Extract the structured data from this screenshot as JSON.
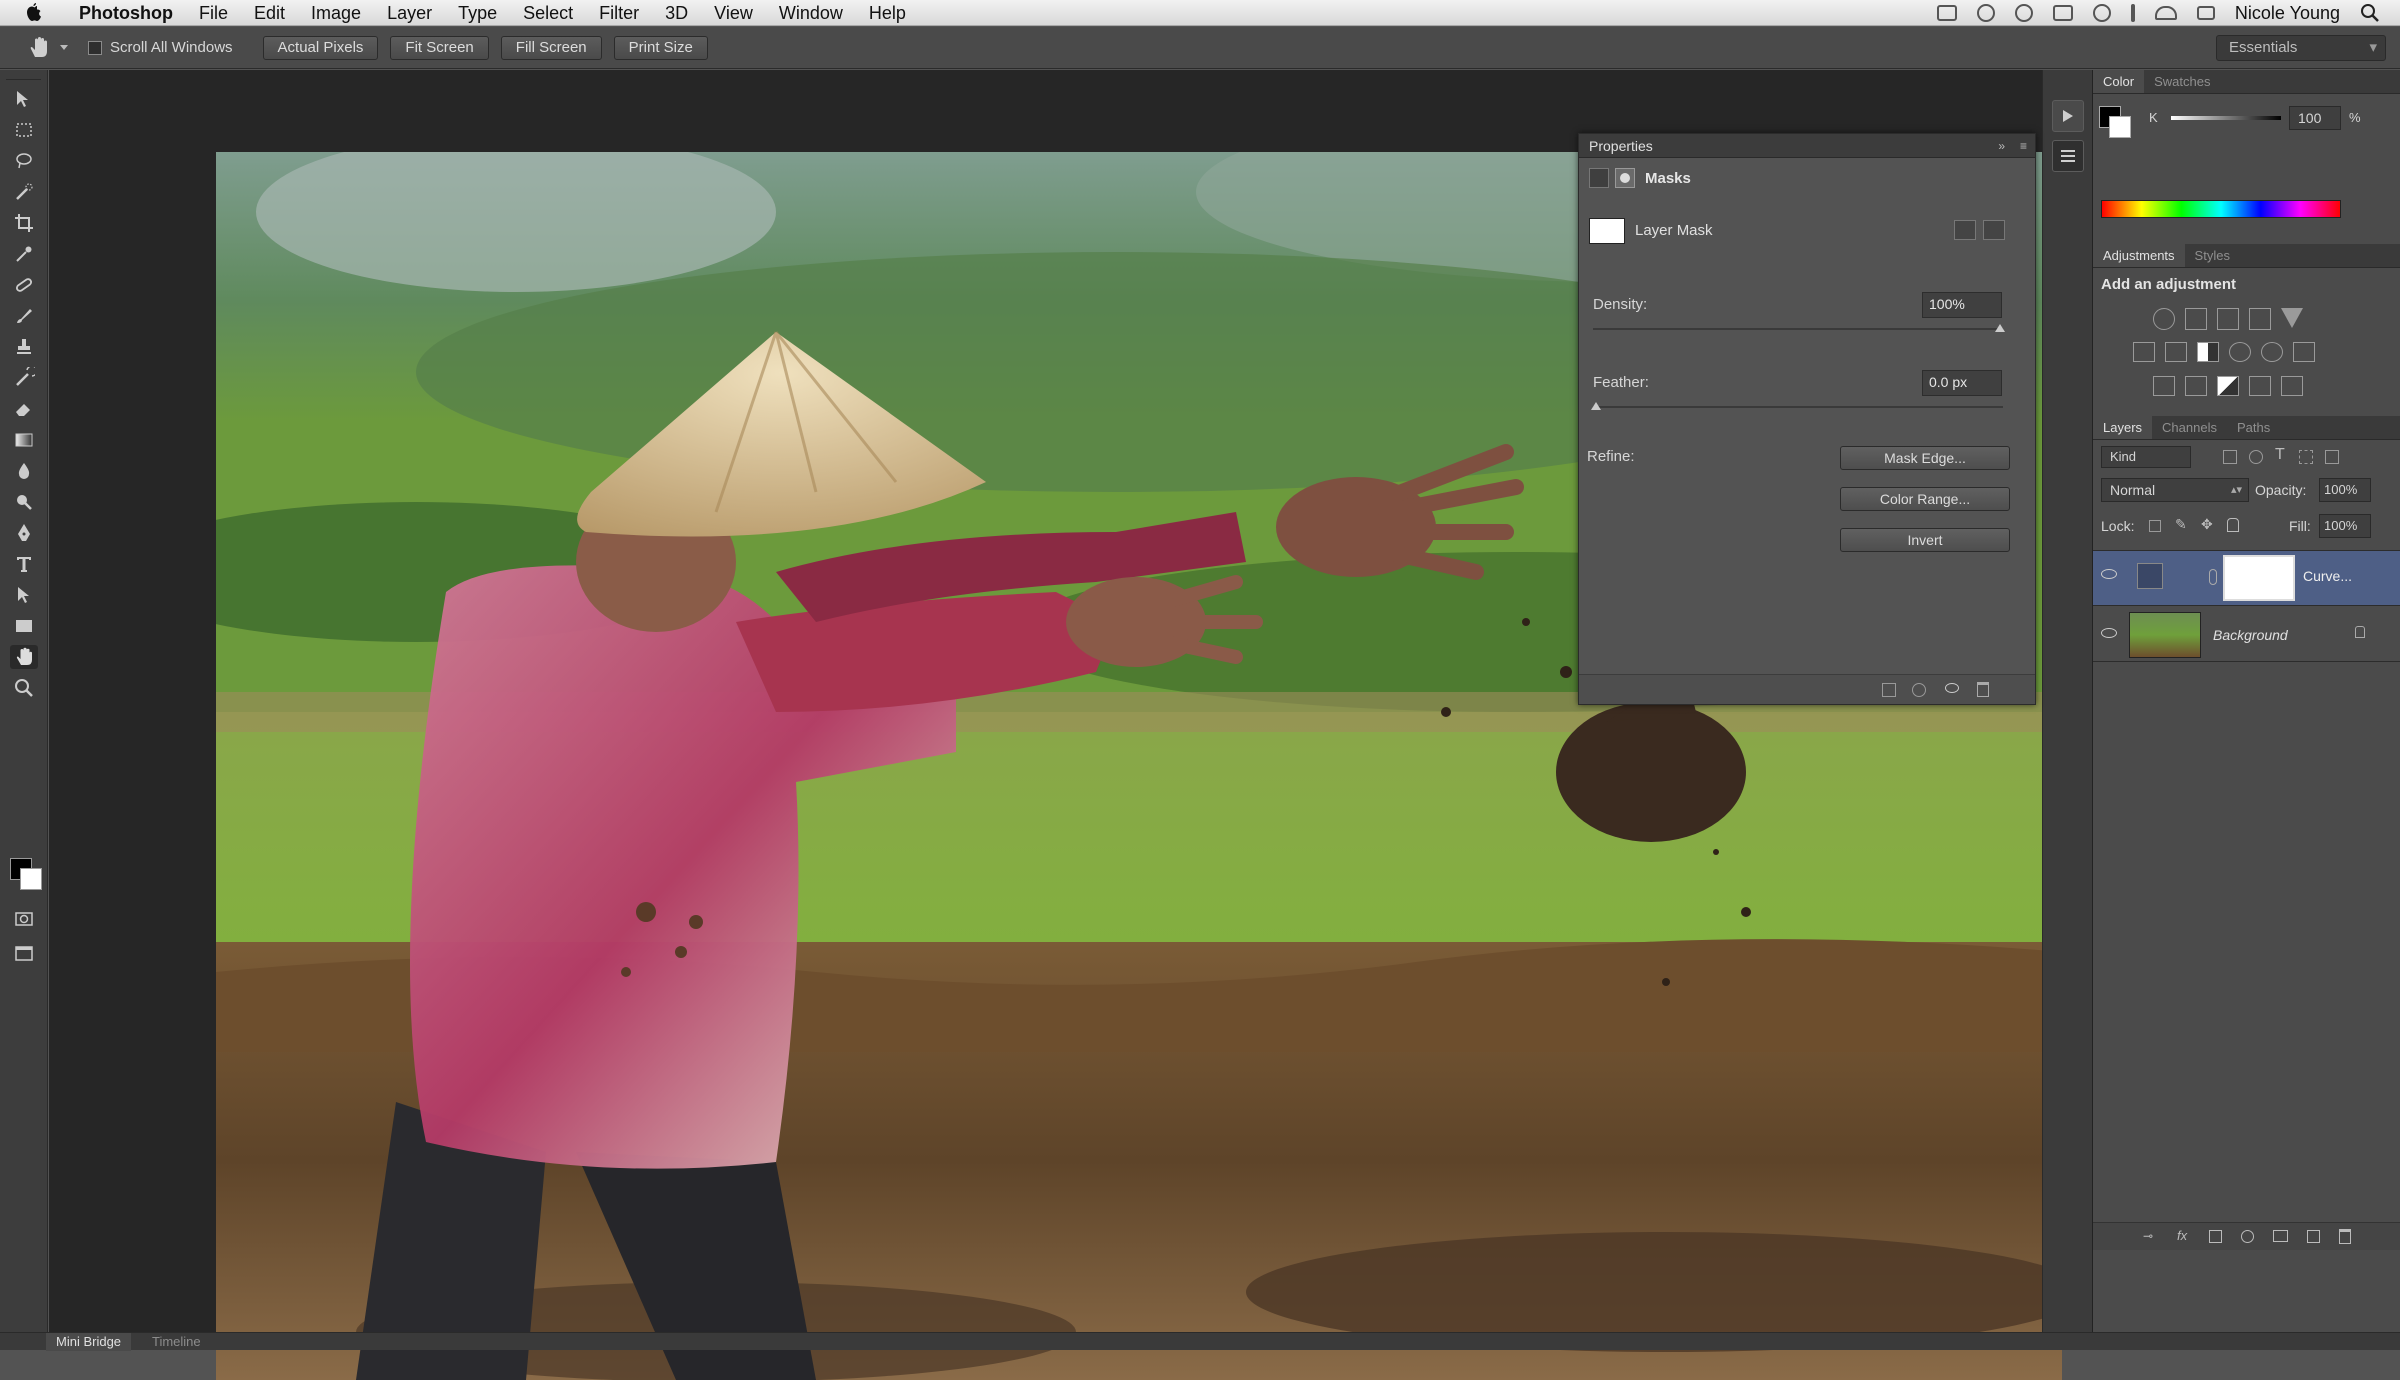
{
  "menubar": {
    "app": "Photoshop",
    "items": [
      "File",
      "Edit",
      "Image",
      "Layer",
      "Type",
      "Select",
      "Filter",
      "3D",
      "View",
      "Window",
      "Help"
    ],
    "user": "Nicole Young"
  },
  "options_bar": {
    "scroll_all_windows_label": "Scroll All Windows",
    "buttons": [
      "Actual Pixels",
      "Fit Screen",
      "Fill Screen",
      "Print Size"
    ],
    "workspace": "Essentials"
  },
  "properties": {
    "title": "Properties",
    "section": "Masks",
    "mask_name": "Layer Mask",
    "density_label": "Density:",
    "density_value": "100%",
    "feather_label": "Feather:",
    "feather_value": "0.0 px",
    "refine_label": "Refine:",
    "mask_edge_button": "Mask Edge...",
    "color_range_button": "Color Range...",
    "invert_button": "Invert"
  },
  "color_panel": {
    "tabs": [
      "Color",
      "Swatches"
    ],
    "channel_label": "K",
    "channel_value": "100",
    "percent": "%"
  },
  "adjustments_panel": {
    "tabs": [
      "Adjustments",
      "Styles"
    ],
    "heading": "Add an adjustment"
  },
  "layers_panel": {
    "tabs": [
      "Layers",
      "Channels",
      "Paths"
    ],
    "kind_label": "Kind",
    "blend_mode": "Normal",
    "opacity_label": "Opacity:",
    "opacity_value": "100%",
    "lock_label": "Lock:",
    "fill_label": "Fill:",
    "fill_value": "100%",
    "layers": [
      {
        "name": "Curve...",
        "selected": true
      },
      {
        "name": "Background",
        "selected": false
      }
    ]
  },
  "bottom_bar": {
    "tabs": [
      "Mini Bridge",
      "Timeline"
    ]
  },
  "colors": {
    "panel_bg": "#4b4b4b",
    "selected_layer": "#4e5f86",
    "canvas_bg": "#262626"
  }
}
